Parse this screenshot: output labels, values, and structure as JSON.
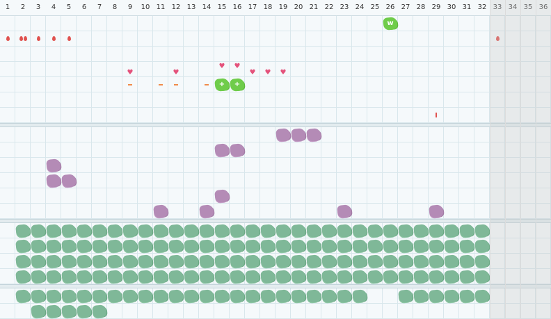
{
  "ruler": {
    "columns": [
      "1",
      "2",
      "3",
      "4",
      "5",
      "6",
      "7",
      "8",
      "9",
      "10",
      "11",
      "12",
      "13",
      "14",
      "15",
      "16",
      "17",
      "18",
      "19",
      "20",
      "21",
      "22",
      "23",
      "24",
      "25",
      "26",
      "27",
      "28",
      "29",
      "30",
      "31",
      "32",
      "33",
      "34",
      "35",
      "36"
    ],
    "disabled_from_column": 33
  },
  "colors": {
    "grid": "#d9e7ec",
    "green_bush": "#7fb898",
    "purple_bush": "#b48bb6",
    "lime_bush": "#6fcc4a",
    "drop": "#e0524f",
    "heart": "#e4527b",
    "dash": "#f08a4a"
  },
  "panels": [
    {
      "name": "panel-markers",
      "rows": 7,
      "lime_bushes": [
        {
          "col": 26,
          "row": 1,
          "text": "w"
        },
        {
          "col": 15,
          "row": 5,
          "text": "+"
        },
        {
          "col": 16,
          "row": 5,
          "text": "+"
        }
      ],
      "drops": [
        {
          "col": 1,
          "row": 2
        },
        {
          "col": 2,
          "row": 2,
          "double": true
        },
        {
          "col": 3,
          "row": 2
        },
        {
          "col": 4,
          "row": 2
        },
        {
          "col": 5,
          "row": 2
        },
        {
          "col": 33,
          "row": 2
        }
      ],
      "hearts": [
        {
          "col": 15,
          "row": 3.9
        },
        {
          "col": 16,
          "row": 3.9
        },
        {
          "col": 9,
          "row": 4.3
        },
        {
          "col": 12,
          "row": 4.3
        },
        {
          "col": 17,
          "row": 4.3
        },
        {
          "col": 18,
          "row": 4.3
        },
        {
          "col": 19,
          "row": 4.3
        }
      ],
      "dashes": [
        {
          "col": 9,
          "row": 5
        },
        {
          "col": 11,
          "row": 5
        },
        {
          "col": 12,
          "row": 5
        },
        {
          "col": 14,
          "row": 5
        }
      ],
      "ticks": [
        {
          "col": 29,
          "row": 7
        }
      ],
      "heart_symbol": "♥"
    },
    {
      "name": "panel-purple",
      "rows": 6,
      "purple_bushes": [
        {
          "col": 19,
          "row": 1
        },
        {
          "col": 20,
          "row": 1
        },
        {
          "col": 21,
          "row": 1
        },
        {
          "col": 15,
          "row": 2
        },
        {
          "col": 16,
          "row": 2
        },
        {
          "col": 4,
          "row": 3
        },
        {
          "col": 4,
          "row": 4
        },
        {
          "col": 5,
          "row": 4
        },
        {
          "col": 15,
          "row": 5
        },
        {
          "col": 11,
          "row": 6
        },
        {
          "col": 14,
          "row": 6
        },
        {
          "col": 23,
          "row": 6
        },
        {
          "col": 29,
          "row": 6
        }
      ]
    },
    {
      "name": "panel-green-full",
      "rows": 4,
      "green_rows": [
        {
          "row": 1,
          "from": 2,
          "to": 32
        },
        {
          "row": 2,
          "from": 2,
          "to": 32
        },
        {
          "row": 3,
          "from": 2,
          "to": 32
        },
        {
          "row": 4,
          "from": 2,
          "to": 32
        }
      ]
    },
    {
      "name": "panel-green-partial",
      "rows": 2,
      "green_rows": [
        {
          "row": 1,
          "from": 2,
          "to": 24
        },
        {
          "row": 1,
          "from": 27,
          "to": 32
        },
        {
          "row": 2,
          "from": 3,
          "to": 7
        }
      ]
    }
  ]
}
